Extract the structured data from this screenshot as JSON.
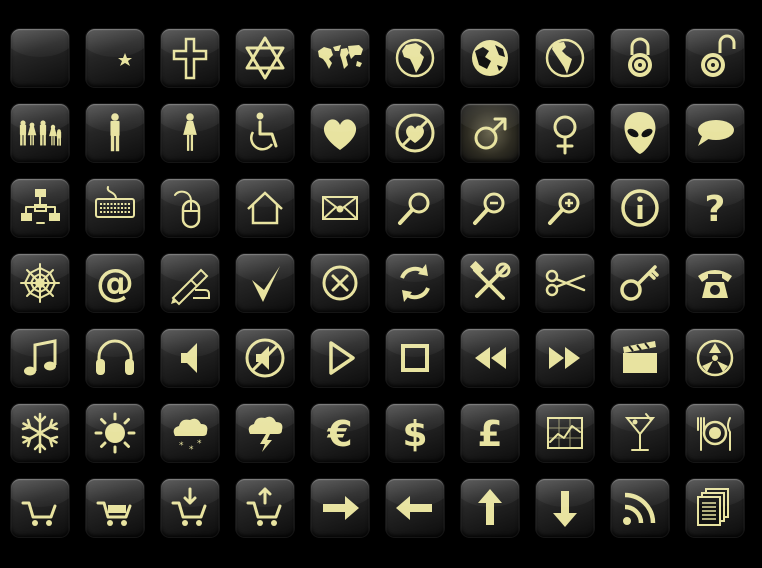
{
  "accent_color": "#e8e3a0",
  "rows": [
    [
      "blank-icon",
      "crescent-star-icon",
      "cross-icon",
      "star-of-david-icon",
      "world-map-icon",
      "globe-africa-icon",
      "globe-asia-icon",
      "globe-americas-icon",
      "padlock-closed-icon",
      "padlock-open-icon"
    ],
    [
      "family-icon",
      "man-icon",
      "woman-icon",
      "wheelchair-icon",
      "heart-icon",
      "no-love-icon",
      "male-symbol-icon",
      "female-symbol-icon",
      "alien-icon",
      "speech-bubble-icon"
    ],
    [
      "network-icon",
      "keyboard-icon",
      "mouse-icon",
      "home-icon",
      "envelope-icon",
      "magnifier-icon",
      "zoom-out-icon",
      "zoom-in-icon",
      "info-icon",
      "question-icon"
    ],
    [
      "spider-web-icon",
      "at-sign-icon",
      "pen-hand-icon",
      "checkmark-icon",
      "cancel-circle-icon",
      "refresh-icon",
      "tools-icon",
      "scissors-icon",
      "key-icon",
      "telephone-icon"
    ],
    [
      "music-note-icon",
      "headphones-icon",
      "speaker-icon",
      "mute-icon",
      "play-icon",
      "stop-icon",
      "rewind-icon",
      "fast-forward-icon",
      "clapperboard-icon",
      "film-reel-icon"
    ],
    [
      "snowflake-icon",
      "sun-icon",
      "snow-cloud-icon",
      "storm-cloud-icon",
      "euro-icon",
      "dollar-icon",
      "pound-icon",
      "line-chart-icon",
      "cocktail-icon",
      "dining-icon"
    ],
    [
      "cart-icon",
      "cart-full-icon",
      "cart-add-icon",
      "cart-remove-icon",
      "arrow-right-icon",
      "arrow-left-icon",
      "arrow-up-icon",
      "arrow-down-icon",
      "rss-feed-icon",
      "documents-icon"
    ]
  ],
  "glyphs": {
    "at": "@",
    "question": "?",
    "euro": "€",
    "dollar": "$",
    "pound": "£"
  }
}
